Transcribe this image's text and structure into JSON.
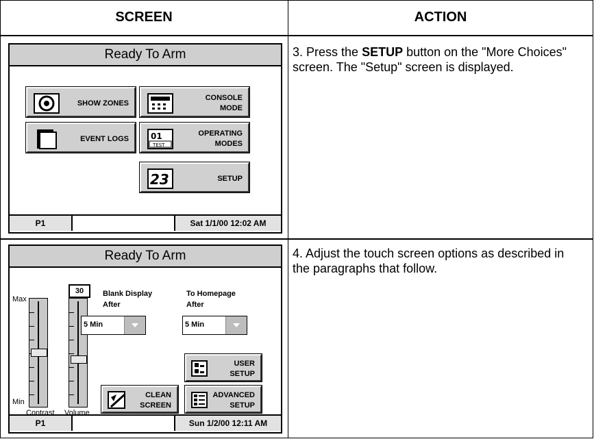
{
  "table": {
    "header_screen": "SCREEN",
    "header_action": "ACTION"
  },
  "row1": {
    "screen": {
      "title": "Ready To Arm",
      "buttons": {
        "show_zones": "SHOW ZONES",
        "console_mode_1": "CONSOLE",
        "console_mode_2": "MODE",
        "event_logs": "EVENT LOGS",
        "operating_modes_1": "OPERATING",
        "operating_modes_2": "MODES",
        "setup": "SETUP"
      },
      "status_left": "P1",
      "status_right": "Sat 1/1/00 12:02 AM"
    },
    "action": {
      "pre": "3.  Press the ",
      "bold": "SETUP",
      "post": " button on the \"More Choices\" screen.  The \"Setup\" screen is displayed."
    }
  },
  "row2": {
    "screen": {
      "title": "Ready To Arm",
      "max_label": "Max",
      "min_label": "Min",
      "volume_value": "30",
      "contrast_label": "Contrast",
      "volume_label": "Volume",
      "blank_display_1": "Blank Display",
      "blank_display_2": "After",
      "blank_display_value": "5 Min",
      "homepage_1": "To Homepage",
      "homepage_2": "After",
      "homepage_value": "5 Min",
      "buttons": {
        "user_setup_1": "USER",
        "user_setup_2": "SETUP",
        "clean_screen_1": "CLEAN",
        "clean_screen_2": "SCREEN",
        "advanced_setup_1": "ADVANCED",
        "advanced_setup_2": "SETUP"
      },
      "status_left": "P1",
      "status_right": "Sun 1/2/00 12:11 AM"
    },
    "action": {
      "text": "4.  Adjust the touch screen options as described in the paragraphs that follow."
    }
  }
}
